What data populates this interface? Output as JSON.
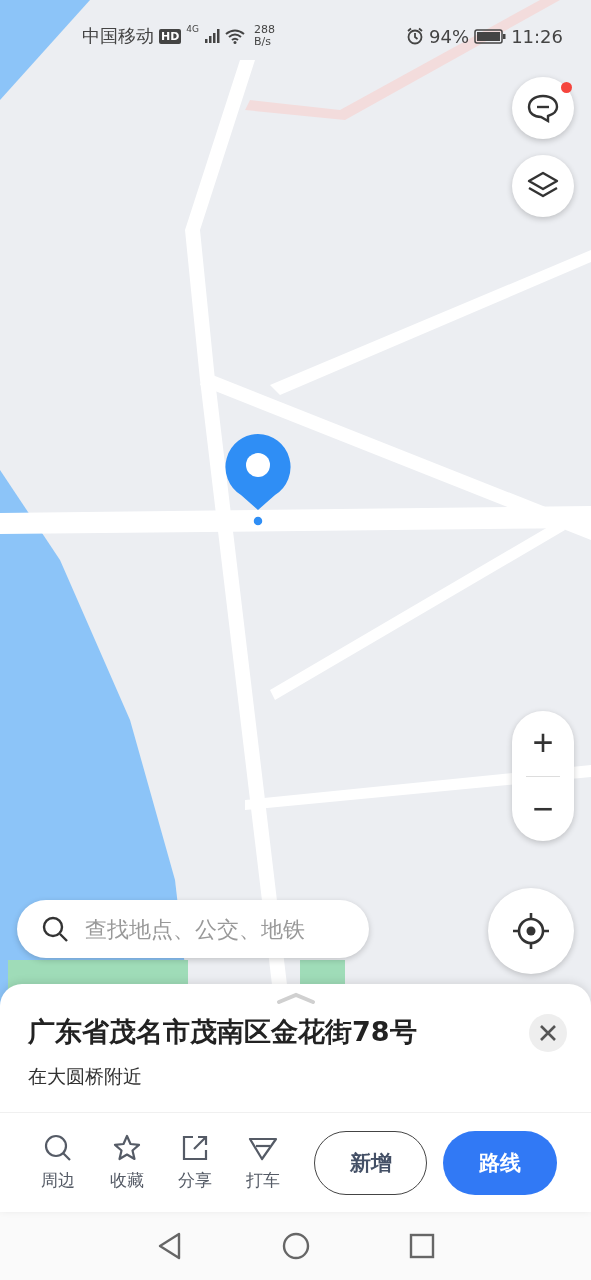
{
  "status_bar": {
    "carrier": "中国移动",
    "hd": "HD",
    "network": "4G",
    "speed": "288",
    "speed_unit": "B/s",
    "battery": "94%",
    "time": "11:26"
  },
  "map": {
    "message_unread": true,
    "zoom_in": "+",
    "zoom_out": "−"
  },
  "search": {
    "placeholder": "查找地点、公交、地铁"
  },
  "place": {
    "title": "广东省茂名市茂南区金花街78号",
    "subtitle": "在大圆桥附近"
  },
  "actions": [
    {
      "label": "周边"
    },
    {
      "label": "收藏"
    },
    {
      "label": "分享"
    },
    {
      "label": "打车"
    }
  ],
  "buttons": [
    {
      "label": "新增",
      "kind": "outline"
    },
    {
      "label": "路线",
      "kind": "primary"
    }
  ]
}
